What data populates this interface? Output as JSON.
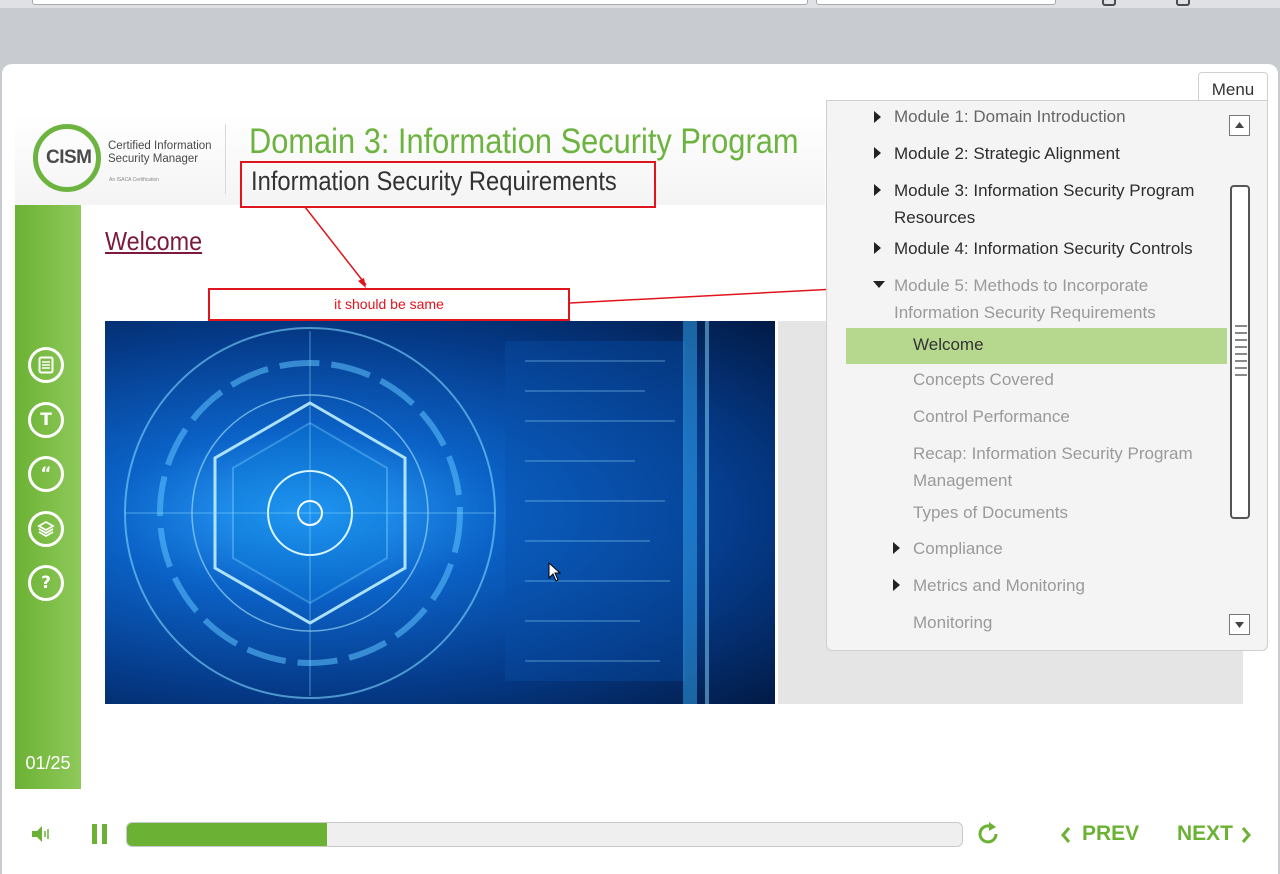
{
  "header": {
    "logo_abbr": "CISM",
    "logo_line1": "Certified Information",
    "logo_line2": "Security Manager",
    "logo_line3": "An ISACA Certification",
    "domain_title": "Domain 3: Information Security Program",
    "sub_title": "Information Security Requirements"
  },
  "content": {
    "heading": "Welcome"
  },
  "annotation": {
    "note": "it should be same"
  },
  "rail": {
    "counter": "01/25"
  },
  "menu": {
    "tab_label": "Menu",
    "items": [
      {
        "label": "Module 1: Domain Introduction"
      },
      {
        "label": "Module 2: Strategic Alignment"
      },
      {
        "label": "Module 3: Information Security Program",
        "label2": "Resources"
      },
      {
        "label": "Module 4: Information Security Controls"
      },
      {
        "label": "Module 5: Methods to Incorporate",
        "label2": "Information Security Requirements"
      }
    ],
    "subitems": [
      {
        "label": "Welcome",
        "selected": true
      },
      {
        "label": "Concepts Covered"
      },
      {
        "label": "Control Performance"
      },
      {
        "label": "Recap: Information Security Program",
        "label2": "Management"
      },
      {
        "label": "Types of Documents"
      },
      {
        "label": "Compliance",
        "expandable": true
      },
      {
        "label": "Metrics and Monitoring",
        "expandable": true
      },
      {
        "label": "Monitoring"
      }
    ]
  },
  "player": {
    "progress": 0.24,
    "prev_label": "PREV",
    "next_label": "NEXT"
  },
  "colors": {
    "accent": "#6bb234",
    "welcome": "#7b1a3e",
    "annotation": "#e0141c",
    "selected_bg": "#b6d88e"
  }
}
